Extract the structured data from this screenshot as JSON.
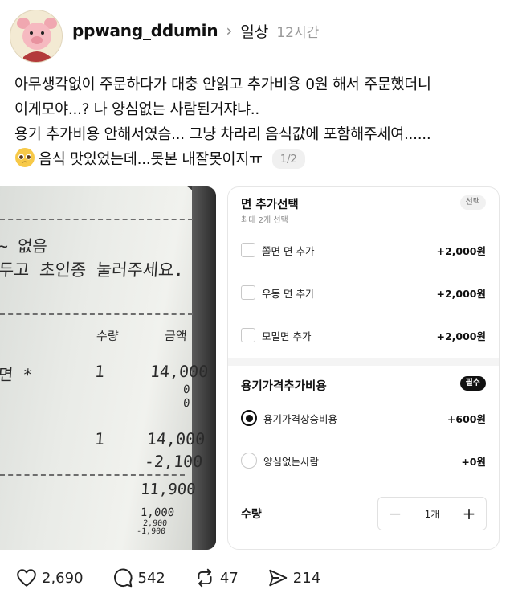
{
  "post": {
    "username": "ppwang_ddumin",
    "topic": "일상",
    "time": "12시간",
    "text_lines": [
      "아무생각없이 주문하다가 대충 안읽고 추가비용 0원 해서 주문했더니",
      "이게모야...? 나 양심없는 사람된거쟈냐..",
      "용기 추가비용 안해서였슴... 그냥 차라리 음식값에 포함해주세여......",
      "음식 맛있었는데...못본 내잘못이지ㅠ"
    ],
    "page_indicator": "1/2"
  },
  "receipt": {
    "lines": [
      "~ 없음",
      "두고 초인종 눌러주세요.",
      "수량",
      "금액",
      "면 *",
      "1",
      "14,000",
      "0",
      "0",
      "1",
      "14,000",
      "-2,100",
      "11,900",
      "1,000",
      "2,900",
      "-1,900"
    ]
  },
  "options_card": {
    "section1": {
      "title": "면 추가선택",
      "subtitle": "최대 2개 선택",
      "tag": "선택",
      "items": [
        {
          "label": "쫄면 면 추가",
          "price": "+2,000원"
        },
        {
          "label": "우동 면 추가",
          "price": "+2,000원"
        },
        {
          "label": "모밀면 추가",
          "price": "+2,000원"
        }
      ]
    },
    "section2": {
      "title": "용기가격추가비용",
      "tag": "필수",
      "items": [
        {
          "label": "용기가격상승비용",
          "price": "+600원",
          "selected": true
        },
        {
          "label": "양심없는사람",
          "price": "+0원",
          "selected": false
        }
      ]
    },
    "quantity": {
      "label": "수량",
      "value": "1개",
      "minus": "−",
      "plus": "+"
    }
  },
  "actions": {
    "likes": "2,690",
    "comments": "542",
    "reposts": "47",
    "shares": "214"
  }
}
